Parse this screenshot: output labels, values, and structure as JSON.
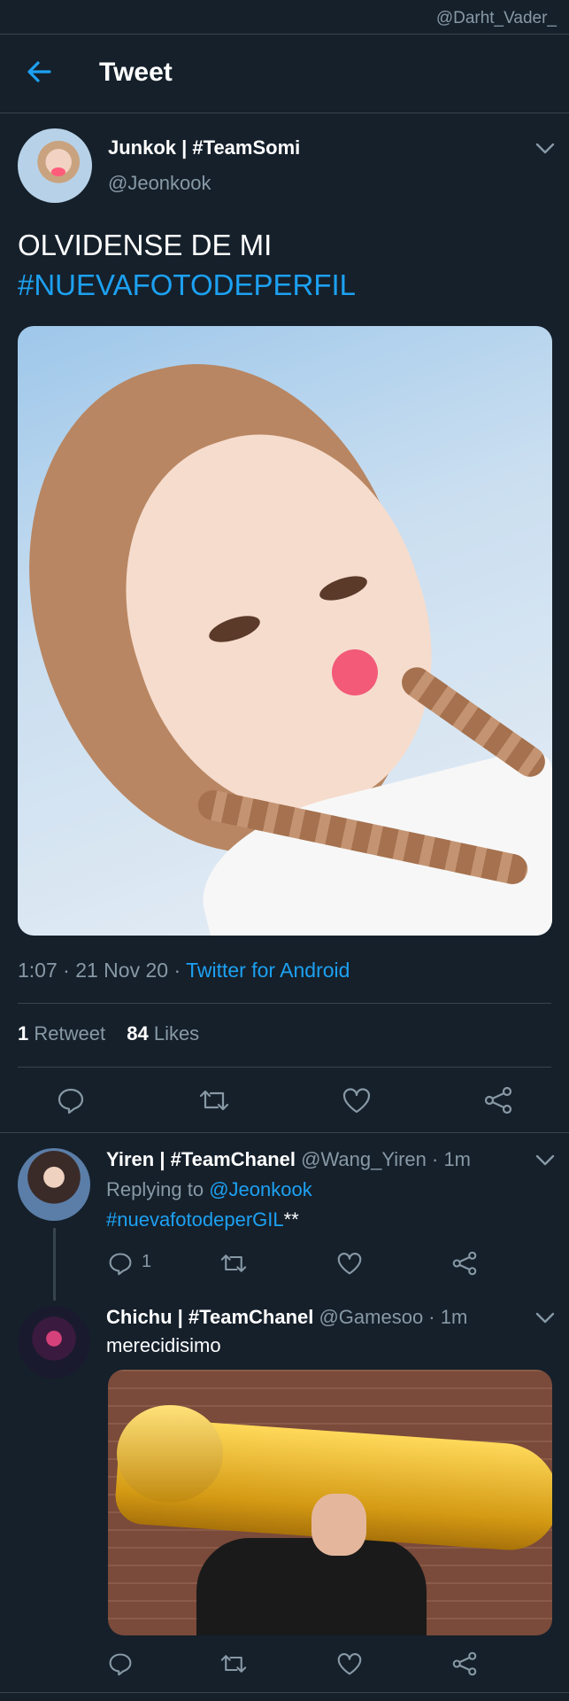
{
  "watermark": "@Darht_Vader_",
  "header": {
    "title": "Tweet"
  },
  "tweet": {
    "author_name": "Junkok | #TeamSomi",
    "author_handle": "@Jeonkook",
    "text_line1": "OLVIDENSE DE MI",
    "hashtag": "#NUEVAFOTODEPERFIL",
    "time_date": "1:07 · 21 Nov 20 · ",
    "source": "Twitter for Android",
    "retweet_count": "1",
    "retweet_label": "Retweet",
    "like_count": "84",
    "like_label": "Likes"
  },
  "replies": [
    {
      "name": "Yiren | #TeamChanel",
      "handle_time": " @Wang_Yiren · 1m",
      "replying_prefix": "Replying to ",
      "replying_to": "@Jeonkook",
      "hashtag": "#nuevafotodeperGIL",
      "suffix": "**",
      "reply_count": "1"
    },
    {
      "name": "Chichu | #TeamChanel",
      "handle_time": " @Gamesoo · 1m",
      "text": "merecidisimo"
    }
  ],
  "icons": [
    "back-arrow-icon",
    "chevron-down-icon",
    "reply-icon",
    "retweet-icon",
    "like-icon",
    "share-icon"
  ],
  "colors": {
    "background": "#15202b",
    "accent": "#1da1f2",
    "muted": "#8899a6",
    "divider": "#38444d"
  }
}
